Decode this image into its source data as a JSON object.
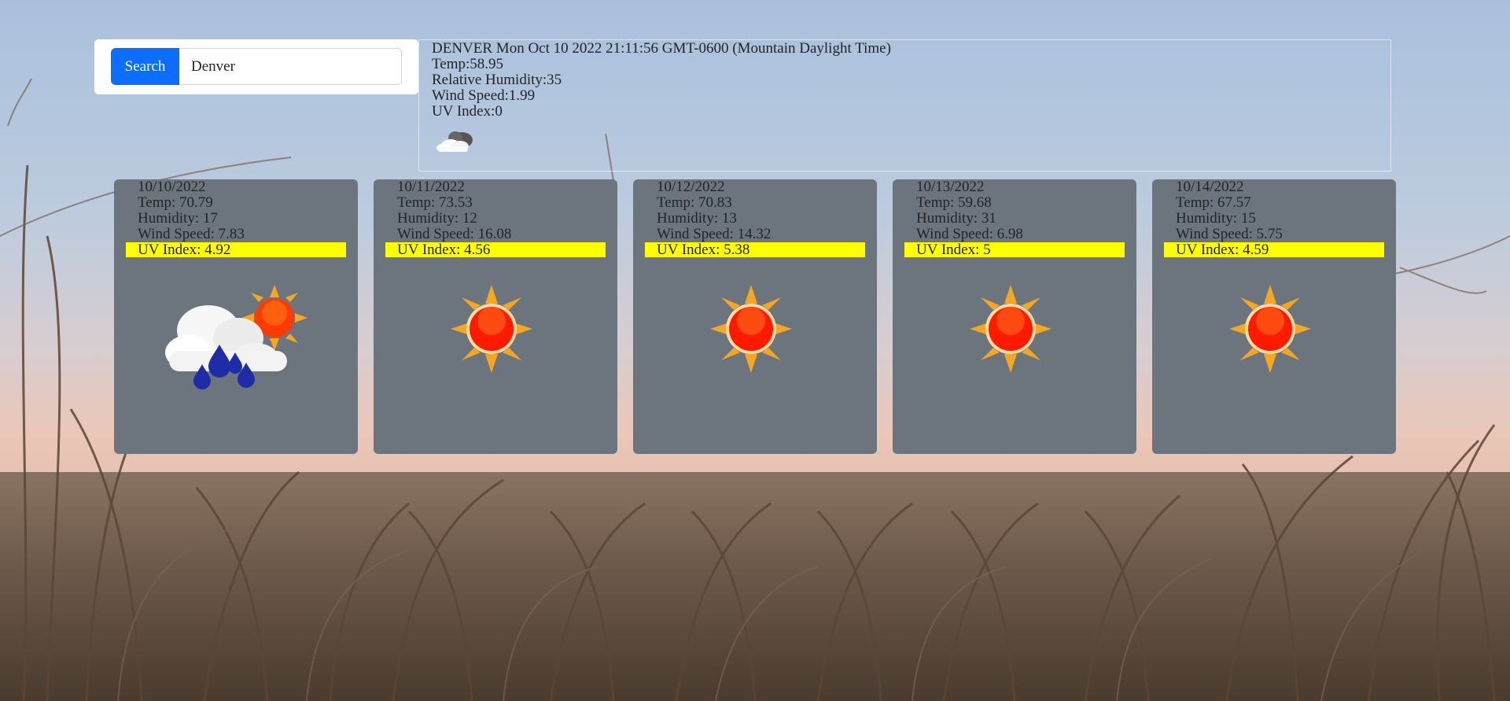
{
  "search": {
    "button_label": "Search",
    "input_value": "Denver"
  },
  "current": {
    "title": "DENVER Mon Oct 10 2022 21:11:56 GMT-0600 (Mountain Daylight Time)",
    "temp": "Temp:58.95",
    "humidity": "Relative Humidity:35",
    "wind": "Wind Speed:1.99",
    "uv": "UV Index:0",
    "icon": "night-cloudy-icon"
  },
  "forecast": [
    {
      "date": "10/10/2022",
      "temp": "Temp: 70.79",
      "humidity": "Humidity: 17",
      "wind": "Wind Speed: 7.83",
      "uv": "UV Index: 4.92",
      "icon": "rain-sun-icon"
    },
    {
      "date": "10/11/2022",
      "temp": "Temp: 73.53",
      "humidity": "Humidity: 12",
      "wind": "Wind Speed: 16.08",
      "uv": "UV Index: 4.56",
      "icon": "sun-icon"
    },
    {
      "date": "10/12/2022",
      "temp": "Temp: 70.83",
      "humidity": "Humidity: 13",
      "wind": "Wind Speed: 14.32",
      "uv": "UV Index: 5.38",
      "icon": "sun-icon"
    },
    {
      "date": "10/13/2022",
      "temp": "Temp: 59.68",
      "humidity": "Humidity: 31",
      "wind": "Wind Speed: 6.98",
      "uv": "UV Index: 5",
      "icon": "sun-icon"
    },
    {
      "date": "10/14/2022",
      "temp": "Temp: 67.57",
      "humidity": "Humidity: 15",
      "wind": "Wind Speed: 5.75",
      "uv": "UV Index: 4.59",
      "icon": "sun-icon"
    }
  ],
  "colors": {
    "accent": "#0d6efd",
    "card": "#6c757d",
    "uv_highlight": "#ffff00"
  }
}
